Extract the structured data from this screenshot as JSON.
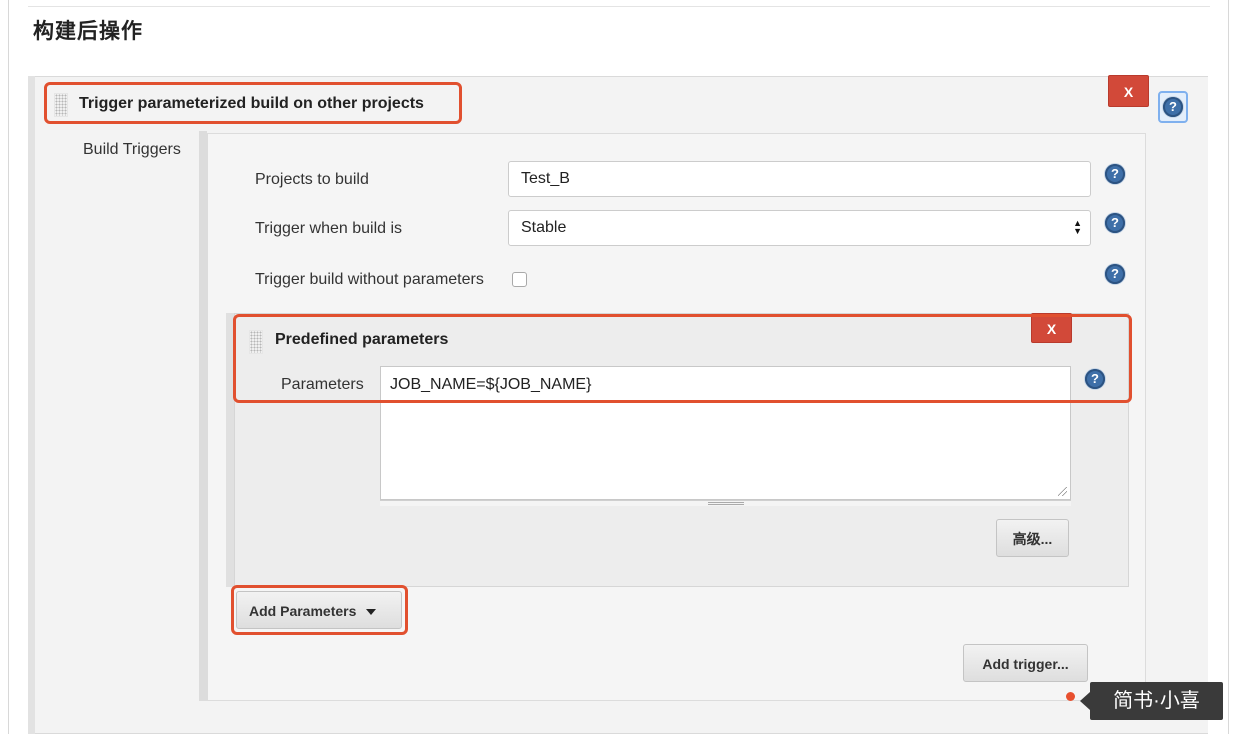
{
  "section": {
    "title": "构建后操作"
  },
  "step": {
    "title": "Trigger parameterized build on other projects",
    "delete_label": "X",
    "help_icon": "question-circle-icon"
  },
  "build_triggers": {
    "label": "Build Triggers",
    "projects_label": "Projects to build",
    "projects_value": "Test_B",
    "trigger_when_label": "Trigger when build is",
    "trigger_when_value": "Stable",
    "no_params_label": "Trigger build without parameters",
    "no_params_checked": false
  },
  "predefined": {
    "title": "Predefined parameters",
    "delete_label": "X",
    "parameters_label": "Parameters",
    "parameters_value": "JOB_NAME=${JOB_NAME}",
    "advanced_label": "高级..."
  },
  "buttons": {
    "add_parameters": "Add Parameters",
    "add_trigger": "Add trigger..."
  },
  "watermark": {
    "text": "简书·小喜"
  },
  "colors": {
    "delete_red": "#d24939",
    "help_blue": "#3e6fa8",
    "highlight": "#e1502f"
  }
}
